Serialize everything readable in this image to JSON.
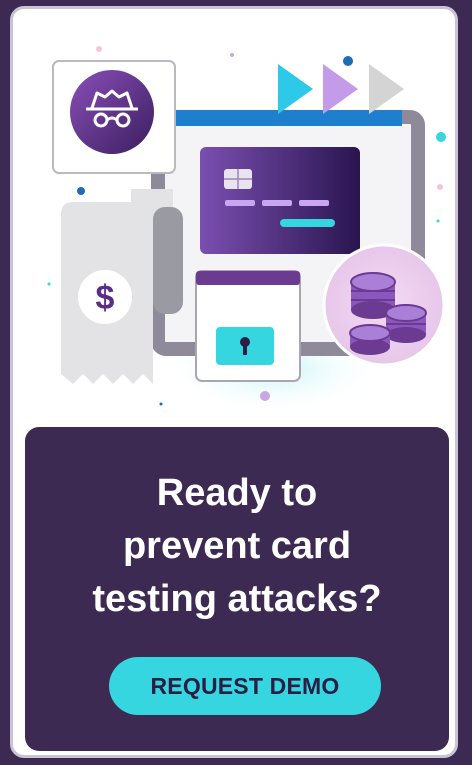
{
  "cta": {
    "headline": "Ready to\nprevent card\ntesting attacks?",
    "button_label": "REQUEST DEMO"
  },
  "illustration": {
    "icons": [
      "incognito-spy-icon",
      "play-arrows-icon",
      "credit-card-icon",
      "receipt-icon",
      "dollar-sign-icon",
      "padlock-icon",
      "coin-stack-icon"
    ]
  },
  "colors": {
    "page_background": "#3d2a52",
    "panel_background": "#3d2a52",
    "accent_cyan": "#35d6e0",
    "brand_purple": "#6b3a91",
    "button_text": "#2a1e44"
  }
}
